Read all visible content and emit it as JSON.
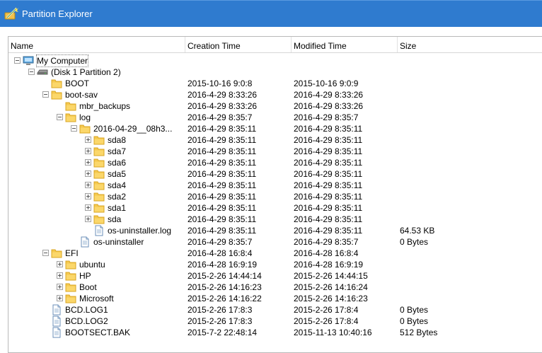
{
  "window": {
    "title": "Partition Explorer"
  },
  "columns": {
    "name": "Name",
    "creation": "Creation Time",
    "modified": "Modified Time",
    "size": "Size"
  },
  "tree": [
    {
      "name": "My Computer",
      "depth": 0,
      "type": "computer",
      "exp": "minus",
      "ct": "",
      "mt": "",
      "size": ""
    },
    {
      "name": "(Disk 1 Partition 2)",
      "depth": 1,
      "type": "drive",
      "exp": "minus",
      "ct": "",
      "mt": "",
      "size": ""
    },
    {
      "name": "BOOT",
      "depth": 2,
      "type": "folder",
      "exp": "none",
      "ct": "2015-10-16 9:0:8",
      "mt": "2015-10-16 9:0:9",
      "size": ""
    },
    {
      "name": "boot-sav",
      "depth": 2,
      "type": "folder",
      "exp": "minus",
      "ct": "2016-4-29 8:33:26",
      "mt": "2016-4-29 8:33:26",
      "size": ""
    },
    {
      "name": "mbr_backups",
      "depth": 3,
      "type": "folder",
      "exp": "none",
      "ct": "2016-4-29 8:33:26",
      "mt": "2016-4-29 8:33:26",
      "size": ""
    },
    {
      "name": "log",
      "depth": 3,
      "type": "folder",
      "exp": "minus",
      "ct": "2016-4-29 8:35:7",
      "mt": "2016-4-29 8:35:7",
      "size": ""
    },
    {
      "name": "2016-04-29__08h3...",
      "depth": 4,
      "type": "folder",
      "exp": "minus",
      "ct": "2016-4-29 8:35:11",
      "mt": "2016-4-29 8:35:11",
      "size": ""
    },
    {
      "name": "sda8",
      "depth": 5,
      "type": "folder",
      "exp": "plus",
      "ct": "2016-4-29 8:35:11",
      "mt": "2016-4-29 8:35:11",
      "size": ""
    },
    {
      "name": "sda7",
      "depth": 5,
      "type": "folder",
      "exp": "plus",
      "ct": "2016-4-29 8:35:11",
      "mt": "2016-4-29 8:35:11",
      "size": ""
    },
    {
      "name": "sda6",
      "depth": 5,
      "type": "folder",
      "exp": "plus",
      "ct": "2016-4-29 8:35:11",
      "mt": "2016-4-29 8:35:11",
      "size": ""
    },
    {
      "name": "sda5",
      "depth": 5,
      "type": "folder",
      "exp": "plus",
      "ct": "2016-4-29 8:35:11",
      "mt": "2016-4-29 8:35:11",
      "size": ""
    },
    {
      "name": "sda4",
      "depth": 5,
      "type": "folder",
      "exp": "plus",
      "ct": "2016-4-29 8:35:11",
      "mt": "2016-4-29 8:35:11",
      "size": ""
    },
    {
      "name": "sda2",
      "depth": 5,
      "type": "folder",
      "exp": "plus",
      "ct": "2016-4-29 8:35:11",
      "mt": "2016-4-29 8:35:11",
      "size": ""
    },
    {
      "name": "sda1",
      "depth": 5,
      "type": "folder",
      "exp": "plus",
      "ct": "2016-4-29 8:35:11",
      "mt": "2016-4-29 8:35:11",
      "size": ""
    },
    {
      "name": "sda",
      "depth": 5,
      "type": "folder",
      "exp": "plus",
      "ct": "2016-4-29 8:35:11",
      "mt": "2016-4-29 8:35:11",
      "size": ""
    },
    {
      "name": "os-uninstaller.log",
      "depth": 5,
      "type": "file",
      "exp": "none",
      "ct": "2016-4-29 8:35:11",
      "mt": "2016-4-29 8:35:11",
      "size": "64.53 KB"
    },
    {
      "name": "os-uninstaller",
      "depth": 4,
      "type": "file",
      "exp": "none",
      "ct": "2016-4-29 8:35:7",
      "mt": "2016-4-29 8:35:7",
      "size": "0 Bytes"
    },
    {
      "name": "EFI",
      "depth": 2,
      "type": "folder",
      "exp": "minus",
      "ct": "2016-4-28 16:8:4",
      "mt": "2016-4-28 16:8:4",
      "size": ""
    },
    {
      "name": "ubuntu",
      "depth": 3,
      "type": "folder",
      "exp": "plus",
      "ct": "2016-4-28 16:9:19",
      "mt": "2016-4-28 16:9:19",
      "size": ""
    },
    {
      "name": "HP",
      "depth": 3,
      "type": "folder",
      "exp": "plus",
      "ct": "2015-2-26 14:44:14",
      "mt": "2015-2-26 14:44:15",
      "size": ""
    },
    {
      "name": "Boot",
      "depth": 3,
      "type": "folder",
      "exp": "plus",
      "ct": "2015-2-26 14:16:23",
      "mt": "2015-2-26 14:16:24",
      "size": ""
    },
    {
      "name": "Microsoft",
      "depth": 3,
      "type": "folder",
      "exp": "plus",
      "ct": "2015-2-26 14:16:22",
      "mt": "2015-2-26 14:16:23",
      "size": ""
    },
    {
      "name": "BCD.LOG1",
      "depth": 2,
      "type": "file",
      "exp": "none",
      "ct": "2015-2-26 17:8:3",
      "mt": "2015-2-26 17:8:4",
      "size": "0 Bytes"
    },
    {
      "name": "BCD.LOG2",
      "depth": 2,
      "type": "file",
      "exp": "none",
      "ct": "2015-2-26 17:8:3",
      "mt": "2015-2-26 17:8:4",
      "size": "0 Bytes"
    },
    {
      "name": "BOOTSECT.BAK",
      "depth": 2,
      "type": "file",
      "exp": "none",
      "ct": "2015-7-2 22:48:14",
      "mt": "2015-11-13 10:40:16",
      "size": "512 Bytes"
    }
  ],
  "colors": {
    "titlebar": "#2f7bcf",
    "folder": "#f5c94f",
    "folder_dark": "#d9a521"
  },
  "icons": {
    "title": "partition-wand-icon",
    "computer": "computer-icon",
    "drive": "drive-icon",
    "folder": "folder-icon",
    "file": "file-icon"
  }
}
